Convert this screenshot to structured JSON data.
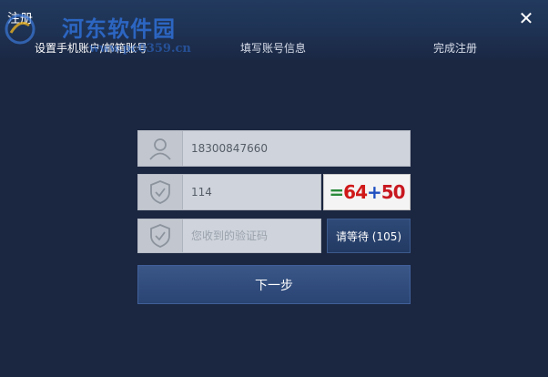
{
  "window": {
    "title": "注册",
    "close_icon": "close-icon"
  },
  "watermark": {
    "text": "河东软件园",
    "url": "www.pc0359.cn"
  },
  "steps": [
    {
      "label": "设置手机账户/邮箱账号",
      "active": true
    },
    {
      "label": "填写账号信息",
      "active": false
    },
    {
      "label": "完成注册",
      "active": false
    }
  ],
  "form": {
    "phone": {
      "value": "18300847660",
      "icon": "user-icon"
    },
    "captcha": {
      "value": "114",
      "icon": "shield-check-icon",
      "image_text": "=64+50"
    },
    "sms_code": {
      "value": "",
      "placeholder": "您收到的验证码",
      "icon": "shield-check-icon"
    },
    "wait_button_label": "请等待 (105)",
    "next_button_label": "下一步"
  },
  "colors": {
    "background": "#1b2640",
    "titlebar": "#223a5e",
    "button": "#2f4a78",
    "field": "#cfd4dc"
  }
}
